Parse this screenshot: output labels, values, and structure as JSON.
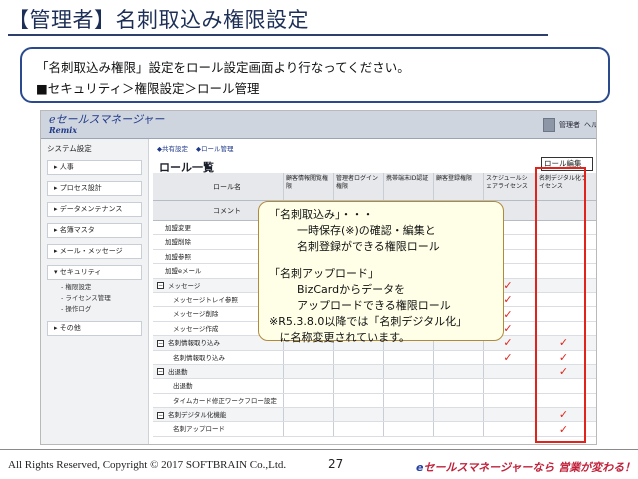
{
  "title": "【管理者】名刺取込み権限設定",
  "intro": {
    "line1": "「名刺取込み権限」設定をロール設定画面より行なってください。",
    "line2": "■セキュリティ＞権限設定＞ロール管理"
  },
  "app": {
    "logo_main": "e",
    "logo_jp": "セールスマネージャー",
    "logo_sub": "Remix",
    "user_label": "管理者",
    "user_help": "ヘル",
    "tabs": [
      "共有設定",
      "ロール管理"
    ],
    "list_title": "ロール一覧",
    "list_header_right": "ロール編集",
    "sidebar": {
      "title": "システム設定",
      "items": [
        "人事",
        "プロセス設計",
        "データメンテナンス",
        "名簿マスタ",
        "メール・メッセージ",
        "セキュリティ",
        "その他"
      ],
      "subitems": [
        "権限設定",
        "ライセンス管理",
        "操作ログ"
      ]
    },
    "table": {
      "header_role": "ロール名",
      "header_comment": "コメント",
      "columns": [
        "顧客情報閲覧権限",
        "管理者ログイン権限",
        "携帯端末ID認証",
        "顧客登録権限",
        "スケジュールシェアライセンス",
        "名刺デジタル化ライセンス"
      ],
      "rows": [
        {
          "label": "加盟変更",
          "type": "item",
          "checks": [
            false,
            false,
            false,
            false,
            false,
            false
          ]
        },
        {
          "label": "加盟削除",
          "type": "item",
          "checks": [
            false,
            false,
            false,
            false,
            false,
            false
          ]
        },
        {
          "label": "加盟参照",
          "type": "item",
          "checks": [
            false,
            false,
            false,
            false,
            false,
            false
          ]
        },
        {
          "label": "加盟eメール",
          "type": "item",
          "checks": [
            false,
            false,
            false,
            false,
            false,
            false
          ]
        },
        {
          "label": "メッセージ",
          "type": "group",
          "checks": [
            false,
            false,
            false,
            false,
            true,
            false
          ]
        },
        {
          "label": "メッセージトレイ参照",
          "type": "sub",
          "checks": [
            false,
            false,
            false,
            false,
            true,
            false
          ]
        },
        {
          "label": "メッセージ削除",
          "type": "sub",
          "checks": [
            false,
            false,
            false,
            false,
            true,
            false
          ]
        },
        {
          "label": "メッセージ作成",
          "type": "sub",
          "checks": [
            false,
            false,
            false,
            false,
            true,
            false
          ]
        },
        {
          "label": "名刺情報取り込み",
          "type": "group",
          "checks": [
            false,
            false,
            false,
            false,
            true,
            true
          ]
        },
        {
          "label": "名刺情報取り込み",
          "type": "sub",
          "checks": [
            false,
            false,
            false,
            false,
            true,
            true
          ]
        },
        {
          "label": "出退勤",
          "type": "group",
          "checks": [
            false,
            false,
            false,
            false,
            false,
            true
          ]
        },
        {
          "label": "出退勤",
          "type": "sub",
          "checks": [
            false,
            false,
            false,
            false,
            false,
            false
          ]
        },
        {
          "label": "タイムカード修正ワークフロー設定",
          "type": "sub",
          "checks": [
            false,
            false,
            false,
            false,
            false,
            false
          ]
        },
        {
          "label": "名刺デジタル化機能",
          "type": "group",
          "checks": [
            false,
            false,
            false,
            false,
            false,
            true
          ]
        },
        {
          "label": "名刺アップロード",
          "type": "sub",
          "checks": [
            false,
            false,
            false,
            false,
            false,
            true
          ]
        }
      ]
    }
  },
  "callout_lines": [
    "「名刺取込み」・・・",
    "        一時保存(※)の確認・編集と",
    "        名刺登録ができる権限ロール",
    "",
    "「名刺アップロード」",
    "        BizCardからデータを",
    "        アップロードできる権限ロール",
    "※R5.3.8.0以降では「名刺デジタル化」",
    "   に名称変更されています。"
  ],
  "footer": {
    "copyright": "All Rights Reserved, Copyright © 2017   SOFTBRAIN Co.,Ltd.",
    "page": "27",
    "brand_e": "e",
    "brand": "セールスマネージャーなら 営業が変わる！"
  },
  "colors": {
    "accent": "#2b4a8e",
    "highlight": "#e0241b"
  }
}
